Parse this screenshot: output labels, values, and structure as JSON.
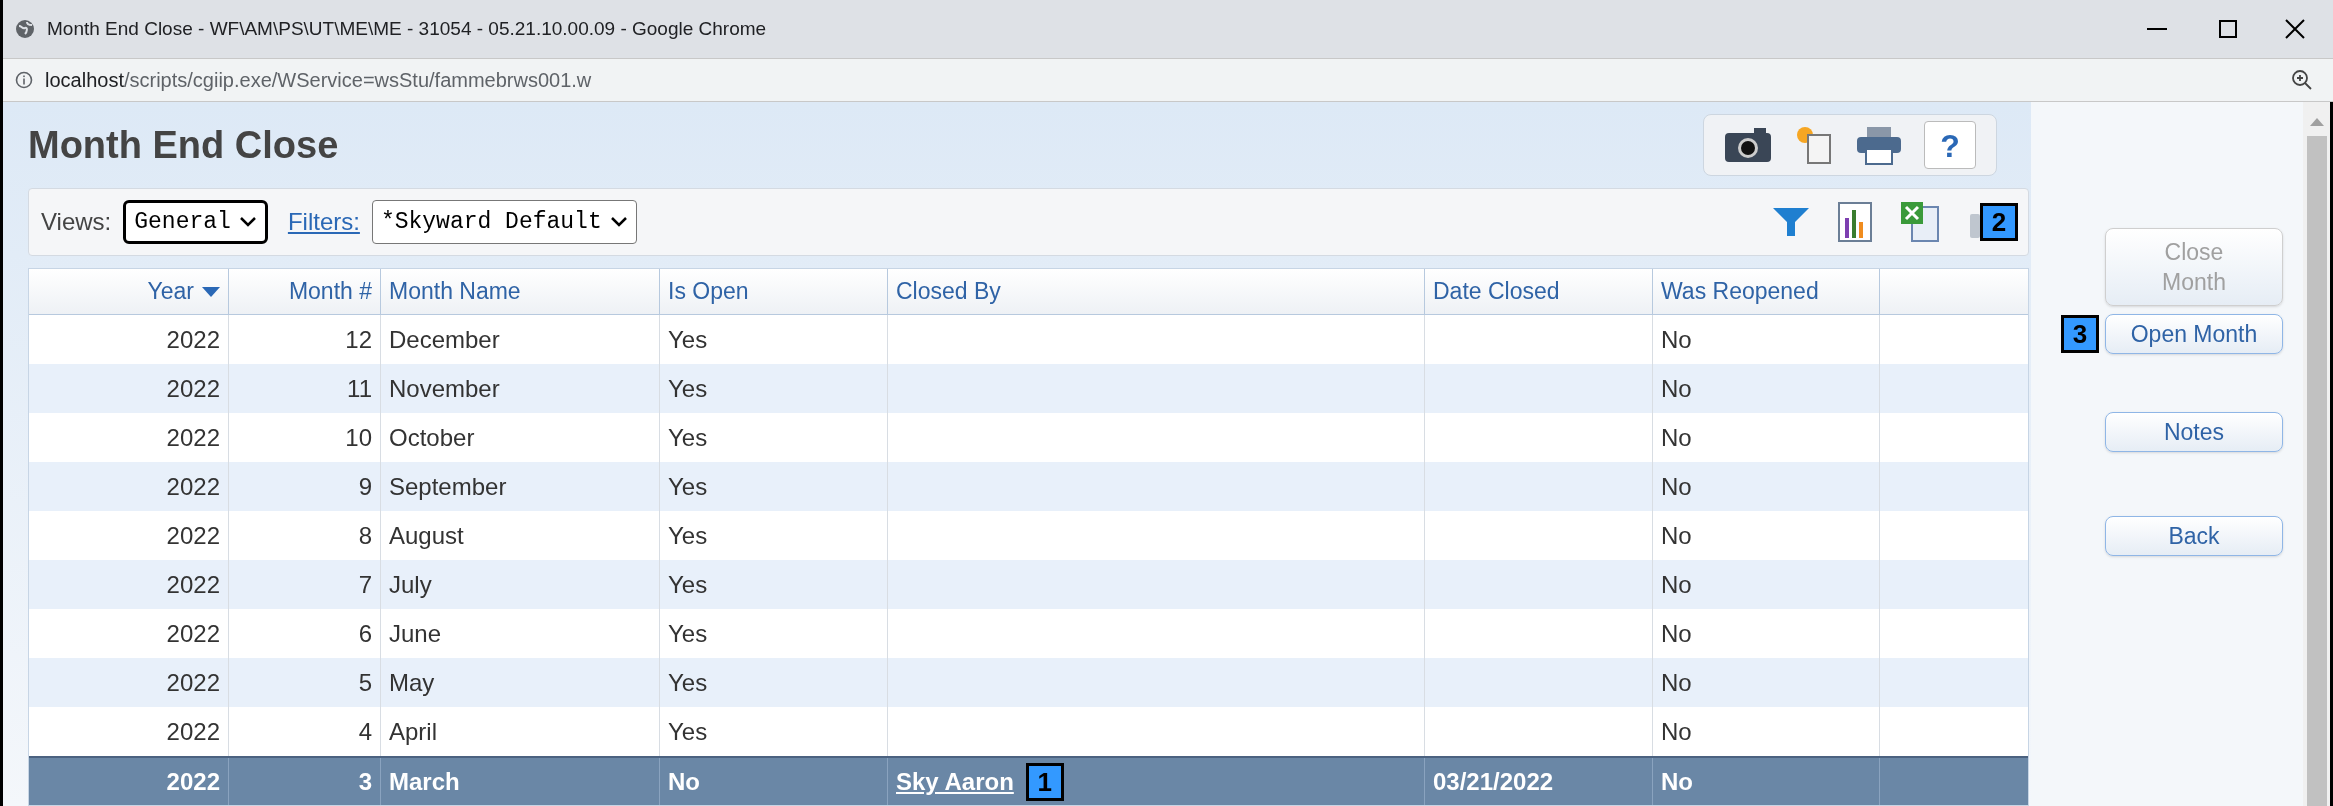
{
  "window": {
    "title": "Month End Close - WF\\AM\\PS\\UT\\ME\\ME - 31054 - 05.21.10.00.09 - Google Chrome"
  },
  "address_bar": {
    "host": "localhost",
    "path": "/scripts/cgiip.exe/WService=wsStu/fammebrws001.w"
  },
  "page": {
    "title": "Month End Close"
  },
  "views": {
    "label": "Views:",
    "value": "General"
  },
  "filters": {
    "label": "Filters:",
    "value": "*Skyward Default"
  },
  "callouts": [
    "1",
    "2",
    "3"
  ],
  "help_button": "?",
  "table": {
    "columns": [
      {
        "label": "Year",
        "sorted": true
      },
      {
        "label": "Month #",
        "sorted": false
      },
      {
        "label": "Month Name",
        "sorted": false
      },
      {
        "label": "Is Open",
        "sorted": false
      },
      {
        "label": "Closed By",
        "sorted": false
      },
      {
        "label": "Date Closed",
        "sorted": false
      },
      {
        "label": "Was Reopened",
        "sorted": false
      }
    ],
    "rows": [
      {
        "selected": false,
        "cells": [
          "2022",
          "12",
          "December",
          "Yes",
          "",
          "",
          "No"
        ]
      },
      {
        "selected": false,
        "cells": [
          "2022",
          "11",
          "November",
          "Yes",
          "",
          "",
          "No"
        ]
      },
      {
        "selected": false,
        "cells": [
          "2022",
          "10",
          "October",
          "Yes",
          "",
          "",
          "No"
        ]
      },
      {
        "selected": false,
        "cells": [
          "2022",
          "9",
          "September",
          "Yes",
          "",
          "",
          "No"
        ]
      },
      {
        "selected": false,
        "cells": [
          "2022",
          "8",
          "August",
          "Yes",
          "",
          "",
          "No"
        ]
      },
      {
        "selected": false,
        "cells": [
          "2022",
          "7",
          "July",
          "Yes",
          "",
          "",
          "No"
        ]
      },
      {
        "selected": false,
        "cells": [
          "2022",
          "6",
          "June",
          "Yes",
          "",
          "",
          "No"
        ]
      },
      {
        "selected": false,
        "cells": [
          "2022",
          "5",
          "May",
          "Yes",
          "",
          "",
          "No"
        ]
      },
      {
        "selected": false,
        "cells": [
          "2022",
          "4",
          "April",
          "Yes",
          "",
          "",
          "No"
        ]
      },
      {
        "selected": true,
        "cells": [
          "2022",
          "3",
          "March",
          "No",
          "Sky Aaron",
          "03/21/2022",
          "No"
        ]
      }
    ]
  },
  "actions": [
    {
      "label": "Close Month",
      "disabled": true
    },
    {
      "label": "Open Month",
      "disabled": false
    },
    {
      "label": "Notes",
      "disabled": false
    },
    {
      "label": "Back",
      "disabled": false
    }
  ]
}
